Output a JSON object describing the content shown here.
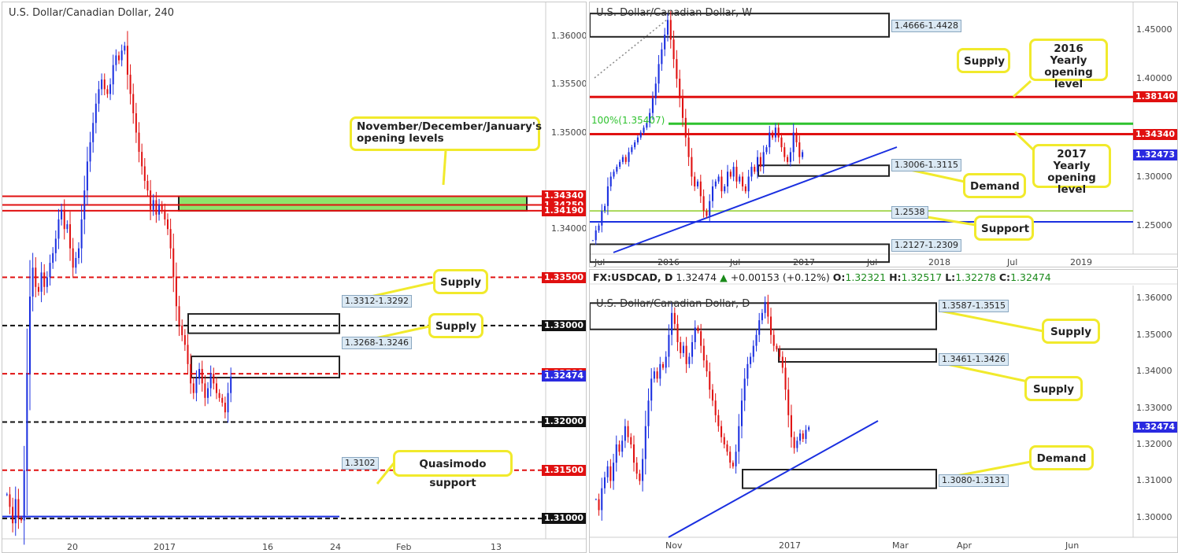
{
  "colors": {
    "bull": "#1a2fe0",
    "bear": "#e01010",
    "level_red": "#e01010",
    "level_black": "#111111",
    "trend": "#1a2fe0",
    "fib": "#2ec22e",
    "support_blue": "#1a2fe0",
    "callout_border": "#f1ea2c",
    "demand_fill": "#8ee36b",
    "price_tag": "#2a2ae0"
  },
  "panels": {
    "h4": {
      "title": "U.S. Dollar/Canadian Dollar, 240"
    },
    "weekly": {
      "title": "U.S. Dollar/Canadian Dollar, W"
    },
    "daily": {
      "title": "U.S. Dollar/Canadian Dollar, D",
      "header": {
        "symbol": "FX:USDCAD, D",
        "price": "1.32474",
        "change": "+0.00153 (+0.12%)",
        "o_label": "O:",
        "o": "1.32321",
        "h_label": "H:",
        "h": "1.32517",
        "l_label": "L:",
        "l": "1.32278",
        "c_label": "C:",
        "c": "1.32474"
      }
    }
  },
  "chart_data": [
    {
      "type": "candlestick",
      "title": "U.S. Dollar/Canadian Dollar, 240",
      "ylim": [
        1.3065,
        1.3635
      ],
      "y_ticks": [
        "1.36000",
        "1.35500",
        "1.35000",
        "1.34000"
      ],
      "x_ticks": [
        "20",
        "2017",
        "16",
        "24",
        "Feb",
        "13"
      ],
      "levels": [
        {
          "price": 1.3434,
          "label": "1.34340",
          "color": "red",
          "style": "solid"
        },
        {
          "price": 1.3425,
          "label": "1.34250",
          "color": "red",
          "style": "solid"
        },
        {
          "price": 1.3419,
          "label": "1.34190",
          "color": "red",
          "style": "solid"
        },
        {
          "price": 1.335,
          "label": "1.33500",
          "color": "red",
          "style": "dashed"
        },
        {
          "price": 1.33,
          "label": "1.33000",
          "color": "black",
          "style": "dashed"
        },
        {
          "price": 1.325,
          "label": "1.32500",
          "color": "red",
          "style": "dashed"
        },
        {
          "price": 1.32,
          "label": "1.32000",
          "color": "black",
          "style": "dashed"
        },
        {
          "price": 1.315,
          "label": "1.31500",
          "color": "red",
          "style": "dashed"
        },
        {
          "price": 1.31,
          "label": "1.31000",
          "color": "black",
          "style": "dashed"
        },
        {
          "price": 1.3102,
          "label": "1.3102",
          "color": "blue",
          "style": "solid"
        }
      ],
      "zones": [
        {
          "label": "1.3312-1.3292",
          "top": 1.3312,
          "bottom": 1.3292
        },
        {
          "label": "1.3268-1.3246",
          "top": 1.3268,
          "bottom": 1.3246
        },
        {
          "label": "",
          "top": 1.3434,
          "bottom": 1.3419,
          "fill": "green"
        }
      ],
      "current_price": "1.32474",
      "annotations": [
        "November/December/January's opening levels",
        "Supply",
        "Supply",
        "Quasimodo support"
      ],
      "close_series": [
        1.3125,
        1.3112,
        1.3095,
        1.312,
        1.31,
        1.3098,
        1.315,
        1.325,
        1.333,
        1.336,
        1.334,
        1.3335,
        1.3355,
        1.334,
        1.335,
        1.3365,
        1.3375,
        1.339,
        1.341,
        1.342,
        1.34,
        1.3405,
        1.338,
        1.336,
        1.337,
        1.338,
        1.341,
        1.344,
        1.347,
        1.349,
        1.351,
        1.353,
        1.3545,
        1.3555,
        1.3545,
        1.354,
        1.355,
        1.357,
        1.358,
        1.3575,
        1.3585,
        1.359,
        1.356,
        1.354,
        1.352,
        1.35,
        1.348,
        1.3465,
        1.345,
        1.344,
        1.342,
        1.343,
        1.3415,
        1.3425,
        1.342,
        1.341,
        1.34,
        1.338,
        1.335,
        1.332,
        1.33,
        1.329,
        1.328,
        1.326,
        1.324,
        1.323,
        1.3245,
        1.3255,
        1.324,
        1.3225,
        1.3235,
        1.325,
        1.324,
        1.323,
        1.3225,
        1.322,
        1.321,
        1.323,
        1.3247
      ]
    },
    {
      "type": "candlestick",
      "title": "U.S. Dollar/Canadian Dollar, W",
      "ylim": [
        1.208,
        1.478
      ],
      "y_ticks": [
        "1.45000",
        "1.40000",
        "1.30000",
        "1.25000"
      ],
      "x_ticks": [
        "Jul",
        "2016",
        "Jul",
        "2017",
        "Jul",
        "2018",
        "Jul",
        "2019"
      ],
      "levels": [
        {
          "price": 1.3814,
          "label": "1.38140",
          "color": "red"
        },
        {
          "price": 1.3434,
          "label": "1.34340",
          "color": "red"
        },
        {
          "price": 1.354,
          "label": "100%(1.35407)",
          "color": "green"
        },
        {
          "price": 1.2538,
          "label": "1.2538",
          "color": "blue"
        },
        {
          "price": 1.265,
          "label": "",
          "color": "lightgreen"
        }
      ],
      "zones": [
        {
          "label": "1.4666-1.4428",
          "top": 1.4666,
          "bottom": 1.4428
        },
        {
          "label": "1.3006-1.3115",
          "top": 1.3115,
          "bottom": 1.3006
        },
        {
          "label": "1.2127-1.2309",
          "top": 1.2309,
          "bottom": 1.2127
        }
      ],
      "current_price": "1.32473",
      "annotations": [
        "Supply",
        "2016 Yearly opening level",
        "2017 Yearly opening level",
        "Demand",
        "Support"
      ],
      "close_series": [
        1.235,
        1.245,
        1.25,
        1.265,
        1.27,
        1.29,
        1.3,
        1.305,
        1.31,
        1.315,
        1.32,
        1.315,
        1.325,
        1.33,
        1.335,
        1.34,
        1.345,
        1.35,
        1.355,
        1.365,
        1.38,
        1.395,
        1.415,
        1.43,
        1.445,
        1.46,
        1.44,
        1.42,
        1.4,
        1.38,
        1.36,
        1.34,
        1.32,
        1.3,
        1.29,
        1.295,
        1.28,
        1.265,
        1.26,
        1.275,
        1.29,
        1.295,
        1.3,
        1.285,
        1.29,
        1.305,
        1.3,
        1.31,
        1.295,
        1.3,
        1.29,
        1.285,
        1.3,
        1.31,
        1.305,
        1.32,
        1.31,
        1.325,
        1.33,
        1.345,
        1.34,
        1.35,
        1.34,
        1.33,
        1.32,
        1.315,
        1.325,
        1.345,
        1.335,
        1.32,
        1.325
      ]
    },
    {
      "type": "candlestick",
      "title": "U.S. Dollar/Canadian Dollar, D",
      "ylim": [
        1.2935,
        1.3635
      ],
      "y_ticks": [
        "1.36000",
        "1.35000",
        "1.34000",
        "1.33000",
        "1.32000",
        "1.31000",
        "1.30000"
      ],
      "x_ticks": [
        "Nov",
        "2017",
        "Mar",
        "Apr",
        "Jun"
      ],
      "zones": [
        {
          "label": "1.3587-1.3515",
          "top": 1.3587,
          "bottom": 1.3515
        },
        {
          "label": "1.3461-1.3426",
          "top": 1.3461,
          "bottom": 1.3426
        },
        {
          "label": "1.3080-1.3131",
          "top": 1.3131,
          "bottom": 1.308
        }
      ],
      "current_price": "1.32474",
      "annotations": [
        "Supply",
        "Supply",
        "Demand"
      ],
      "close_series": [
        1.305,
        1.302,
        1.308,
        1.311,
        1.314,
        1.31,
        1.315,
        1.32,
        1.318,
        1.321,
        1.325,
        1.322,
        1.32,
        1.315,
        1.312,
        1.31,
        1.316,
        1.325,
        1.332,
        1.338,
        1.34,
        1.338,
        1.342,
        1.341,
        1.344,
        1.35,
        1.356,
        1.353,
        1.348,
        1.345,
        1.347,
        1.342,
        1.344,
        1.348,
        1.352,
        1.351,
        1.347,
        1.343,
        1.34,
        1.335,
        1.332,
        1.328,
        1.325,
        1.322,
        1.32,
        1.318,
        1.315,
        1.314,
        1.318,
        1.325,
        1.332,
        1.338,
        1.342,
        1.344,
        1.347,
        1.35,
        1.354,
        1.356,
        1.359,
        1.355,
        1.35,
        1.347,
        1.346,
        1.344,
        1.341,
        1.335,
        1.328,
        1.322,
        1.319,
        1.321,
        1.323,
        1.3215,
        1.324,
        1.3247
      ]
    }
  ]
}
